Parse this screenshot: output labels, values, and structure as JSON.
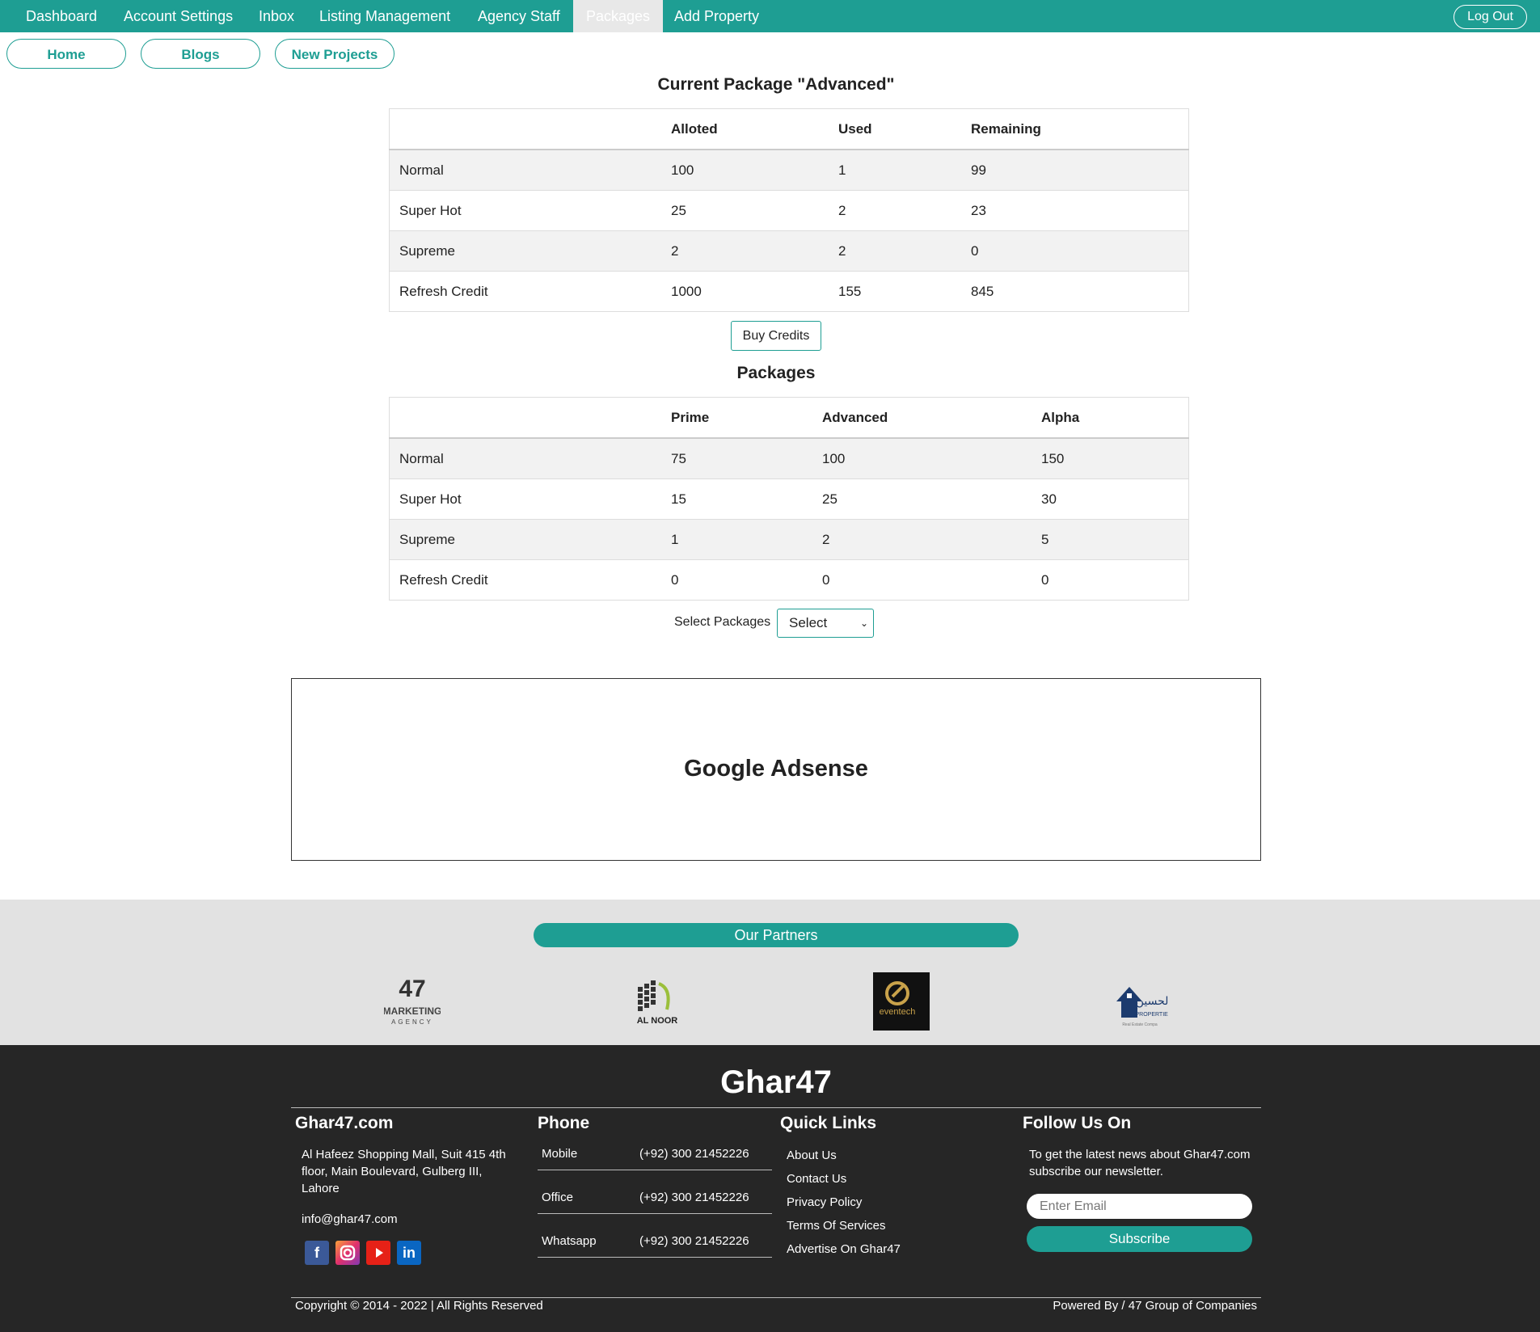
{
  "nav": {
    "items": [
      "Dashboard",
      "Account Settings",
      "Inbox",
      "Listing Management",
      "Agency Staff",
      "Packages",
      "Add Property"
    ],
    "active": "Packages",
    "logout": "Log Out"
  },
  "quick_links": [
    "Home",
    "Blogs",
    "New Projects"
  ],
  "current_package": {
    "title": "Current Package \"Advanced\"",
    "headers": [
      "",
      "Alloted",
      "Used",
      "Remaining"
    ],
    "rows": [
      [
        "Normal",
        "100",
        "1",
        "99"
      ],
      [
        "Super Hot",
        "25",
        "2",
        "23"
      ],
      [
        "Supreme",
        "2",
        "2",
        "0"
      ],
      [
        "Refresh Credit",
        "1000",
        "155",
        "845"
      ]
    ],
    "buy_button": "Buy Credits"
  },
  "packages": {
    "title": "Packages",
    "headers": [
      "",
      "Prime",
      "Advanced",
      "Alpha"
    ],
    "rows": [
      [
        "Normal",
        "75",
        "100",
        "150"
      ],
      [
        "Super Hot",
        "15",
        "25",
        "30"
      ],
      [
        "Supreme",
        "1",
        "2",
        "5"
      ],
      [
        "Refresh Credit",
        "0",
        "0",
        "0"
      ]
    ],
    "select_label": "Select Packages",
    "select_value": "Select"
  },
  "ad": {
    "text": "Google Adsense"
  },
  "partners": {
    "title": "Our Partners",
    "logos": [
      "47 Marketing Agency",
      "Al Noor",
      "Eventech",
      "Al Hussain Properties"
    ]
  },
  "footer": {
    "brand": "Ghar47",
    "company": {
      "title": "Ghar47.com",
      "address": "Al Hafeez Shopping Mall, Suit 415 4th floor, Main Boulevard, Gulberg III, Lahore",
      "email": "info@ghar47.com"
    },
    "phone": {
      "title": "Phone",
      "rows": [
        {
          "label": "Mobile",
          "value": "(+92) 300 21452226"
        },
        {
          "label": "Office",
          "value": "(+92) 300 21452226"
        },
        {
          "label": "Whatsapp",
          "value": "(+92) 300 21452226"
        }
      ]
    },
    "quick_links": {
      "title": "Quick Links",
      "items": [
        "About Us",
        "Contact Us",
        "Privacy Policy",
        "Terms Of Services",
        "Advertise On Ghar47"
      ]
    },
    "follow": {
      "title": "Follow Us On",
      "text": "To get the latest news about Ghar47.com subscribe our newsletter.",
      "email_placeholder": "Enter Email",
      "subscribe": "Subscribe"
    },
    "copyright": "Copyright © 2014 - 2022 | All Rights Reserved",
    "powered": "Powered By / 47 Group of Companies"
  },
  "colors": {
    "accent": "#1e9e93",
    "footer_bg": "#262626",
    "partners_bg": "#e2e2e2"
  }
}
